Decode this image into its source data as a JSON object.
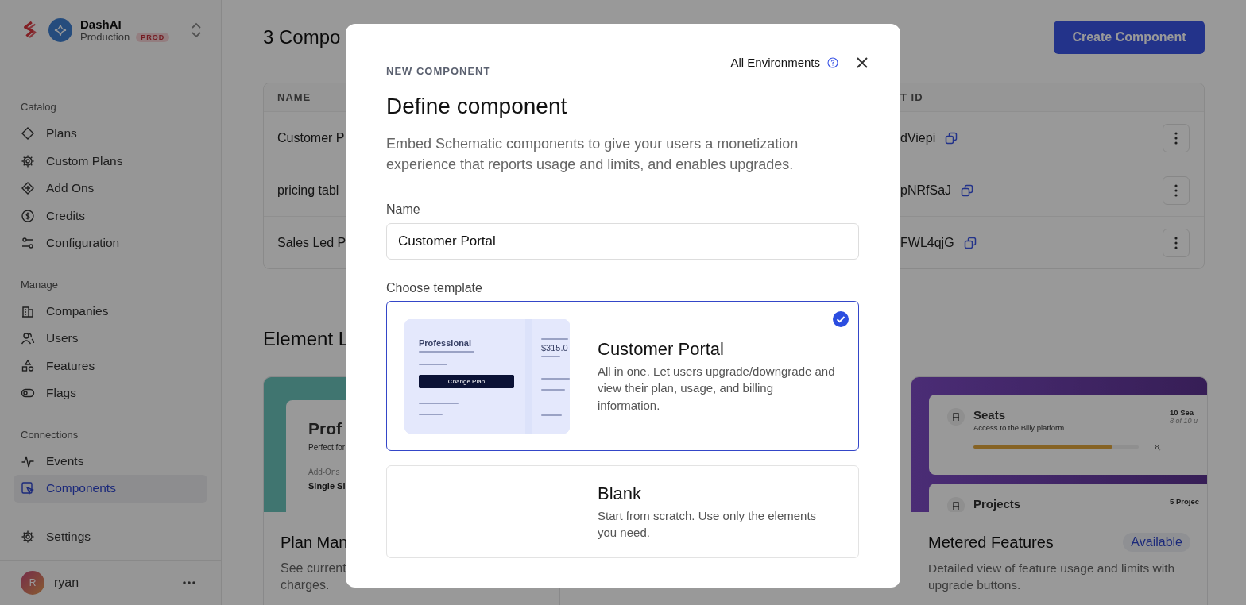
{
  "sidebar": {
    "org": {
      "name": "DashAI",
      "environment": "Production",
      "badge": "PROD"
    },
    "sections": [
      {
        "title": "Catalog",
        "items": [
          {
            "label": "Plans",
            "selected": false
          },
          {
            "label": "Custom Plans",
            "selected": false
          },
          {
            "label": "Add Ons",
            "selected": false
          },
          {
            "label": "Credits",
            "selected": false
          },
          {
            "label": "Configuration",
            "selected": false
          }
        ]
      },
      {
        "title": "Manage",
        "items": [
          {
            "label": "Companies",
            "selected": false
          },
          {
            "label": "Users",
            "selected": false
          },
          {
            "label": "Features",
            "selected": false
          },
          {
            "label": "Flags",
            "selected": false
          }
        ]
      },
      {
        "title": "Connections",
        "items": [
          {
            "label": "Events",
            "selected": false
          },
          {
            "label": "Components",
            "selected": true
          }
        ]
      },
      {
        "items": [
          {
            "label": "Settings",
            "selected": false
          }
        ]
      }
    ],
    "user": {
      "initial": "R",
      "name": "ryan"
    }
  },
  "page": {
    "title": "3 Compo",
    "create_button": "Create Component",
    "table": {
      "columns": [
        "NAME",
        "T ID"
      ],
      "rows": [
        {
          "name": "Customer P",
          "id": "dViepi"
        },
        {
          "name": "pricing tabl",
          "id": "pNRfSaJ"
        },
        {
          "name": "Sales Led P",
          "id": "FWL4qjG"
        }
      ]
    },
    "library_title": "Element L",
    "cards": [
      {
        "kind": "plan",
        "title": "Plan Man",
        "description_lines": [
          "See current",
          "charges."
        ],
        "preview": {
          "heading": "Prof",
          "subheading": "Perfect for",
          "label": "Add-Ons",
          "value": "Single Si"
        }
      },
      {
        "kind": "metered",
        "title": "Metered Features",
        "badge": "Available",
        "description": "Detailed view of feature usage and limits with upgrade buttons.",
        "preview": {
          "features": [
            {
              "name": "Seats",
              "description": "Access to the Billy platform.",
              "limit": "10 Sea",
              "usage": "8 of 10 u",
              "level": 0.84,
              "reading": "8,"
            },
            {
              "name": "Projects",
              "limit": "5 Projec"
            }
          ]
        }
      }
    ]
  },
  "modal": {
    "eyebrow": "NEW COMPONENT",
    "environment": "All Environments",
    "title": "Define component",
    "description": "Embed Schematic components to give your users a monetization experience that reports usage and limits, and enables upgrades.",
    "name_label": "Name",
    "name_value": "Customer Portal",
    "template_label": "Choose template",
    "templates": [
      {
        "kind": "preview",
        "title": "Customer Portal",
        "description": "All in one. Let users upgrade/downgrade and view their plan, usage, and billing information.",
        "selected": true,
        "preview": {
          "plan": "Professional",
          "amount": "$315.0",
          "button": "Change Plan"
        }
      },
      {
        "kind": "blank",
        "title": "Blank",
        "description": "Start from scratch. Use only the elements you need.",
        "selected": false
      }
    ]
  }
}
